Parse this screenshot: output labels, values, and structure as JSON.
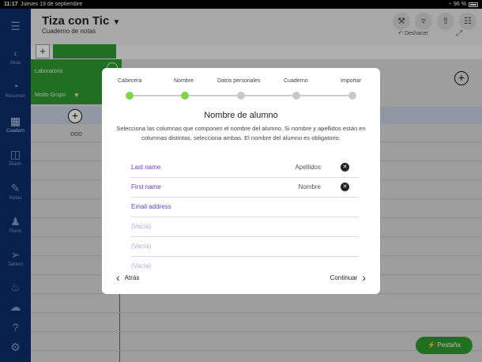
{
  "status_bar": {
    "time": "11:17",
    "date": "Jueves 19 de septiembre",
    "battery": "96 %"
  },
  "sidebar": {
    "items": [
      {
        "icon": "back-chevron",
        "label": "Atrás"
      },
      {
        "icon": "pie-chart",
        "label": "Resumen"
      },
      {
        "icon": "grid",
        "label": "Cuadern"
      },
      {
        "icon": "book",
        "label": "Diario"
      },
      {
        "icon": "pencil",
        "label": "Notas"
      },
      {
        "icon": "people",
        "label": "Plano"
      },
      {
        "icon": "pin",
        "label": "Tablero"
      },
      {
        "icon": "bell",
        "label": ""
      },
      {
        "icon": "cloud",
        "label": ""
      },
      {
        "icon": "question",
        "label": ""
      },
      {
        "icon": "gear",
        "label": ""
      }
    ]
  },
  "header": {
    "title": "Tiza con Tic",
    "subtitle": "Cuaderno de notas",
    "undo_label": "Deshacer"
  },
  "grid": {
    "group_title": "Laboratorio",
    "mode_label": "Modo Grupo",
    "dots": "ooo"
  },
  "pestana_button": "Pestaña",
  "modal": {
    "steps": [
      "Cabecera",
      "Nombre",
      "Datos personales",
      "Cuaderno",
      "Importar"
    ],
    "title": "Nombre de alumno",
    "description": "Selecciona las columnas que componen el nombre del alumno. Si nombre y apellidos están en columnas distintas, selecciona ambas. El nombre del alumno es obligatorio.",
    "rows": [
      {
        "label": "Last name",
        "value": "Apellidos",
        "selected": true
      },
      {
        "label": "First name",
        "value": "Nombre",
        "selected": true
      },
      {
        "label": "Email address",
        "value": "",
        "selected": false
      },
      {
        "label": "(Vacía)",
        "value": "",
        "selected": false
      },
      {
        "label": "(Vacía)",
        "value": "",
        "selected": false
      },
      {
        "label": "(Vacía)",
        "value": "",
        "selected": false
      }
    ],
    "back_label": "Atrás",
    "next_label": "Continuar"
  }
}
